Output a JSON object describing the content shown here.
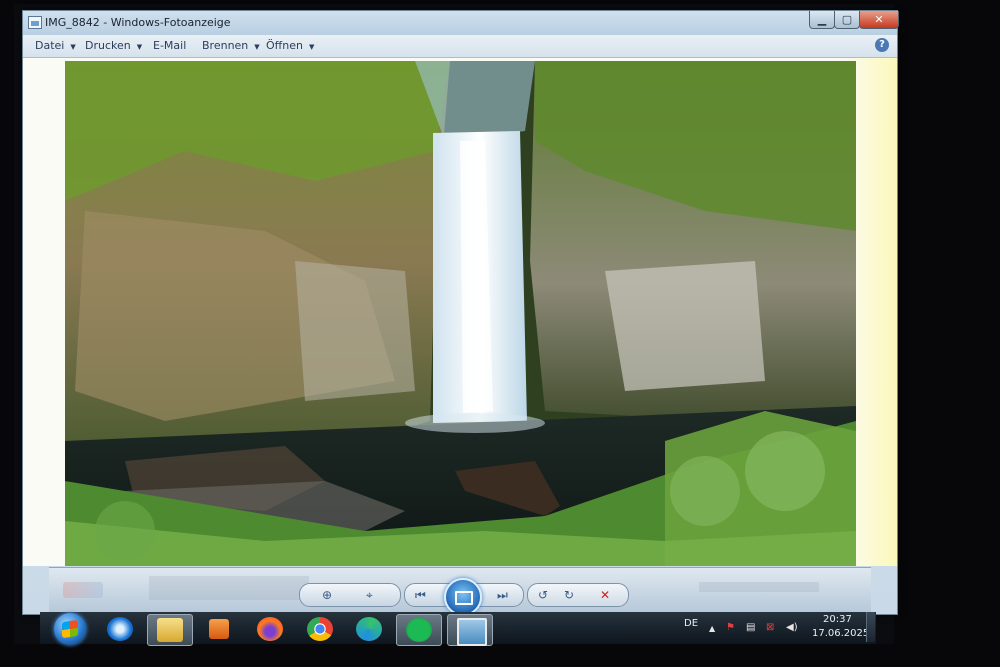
{
  "window": {
    "title": "IMG_8842 - Windows-Fotoanzeige",
    "min_glyph": "▁",
    "max_glyph": "▢",
    "close_glyph": "✕"
  },
  "menu": {
    "items": [
      "Datei",
      "Drucken",
      "E-Mail",
      "Brennen",
      "Öffnen"
    ],
    "arrow": "▼",
    "help_glyph": "?"
  },
  "photo": {
    "subject": "waterfall-photo"
  },
  "controls": {
    "zoom_glyph": "⊕",
    "fit_glyph": "⌖",
    "prev_glyph": "⏮",
    "next_glyph": "⏭",
    "rotate_left_glyph": "↺",
    "rotate_right_glyph": "↻",
    "delete_glyph": "✕"
  },
  "taskbar": {
    "apps": [
      "internet-explorer",
      "file-explorer",
      "media-player",
      "firefox",
      "chrome",
      "edge",
      "spotify",
      "photo-viewer"
    ],
    "language": "DE",
    "time": "20:37",
    "date": "17.06.2025",
    "tray_up_glyph": "▲"
  },
  "colors": {
    "accent": "#2f7fd0",
    "close_red": "#c4391f",
    "delete_red": "#d02020"
  }
}
